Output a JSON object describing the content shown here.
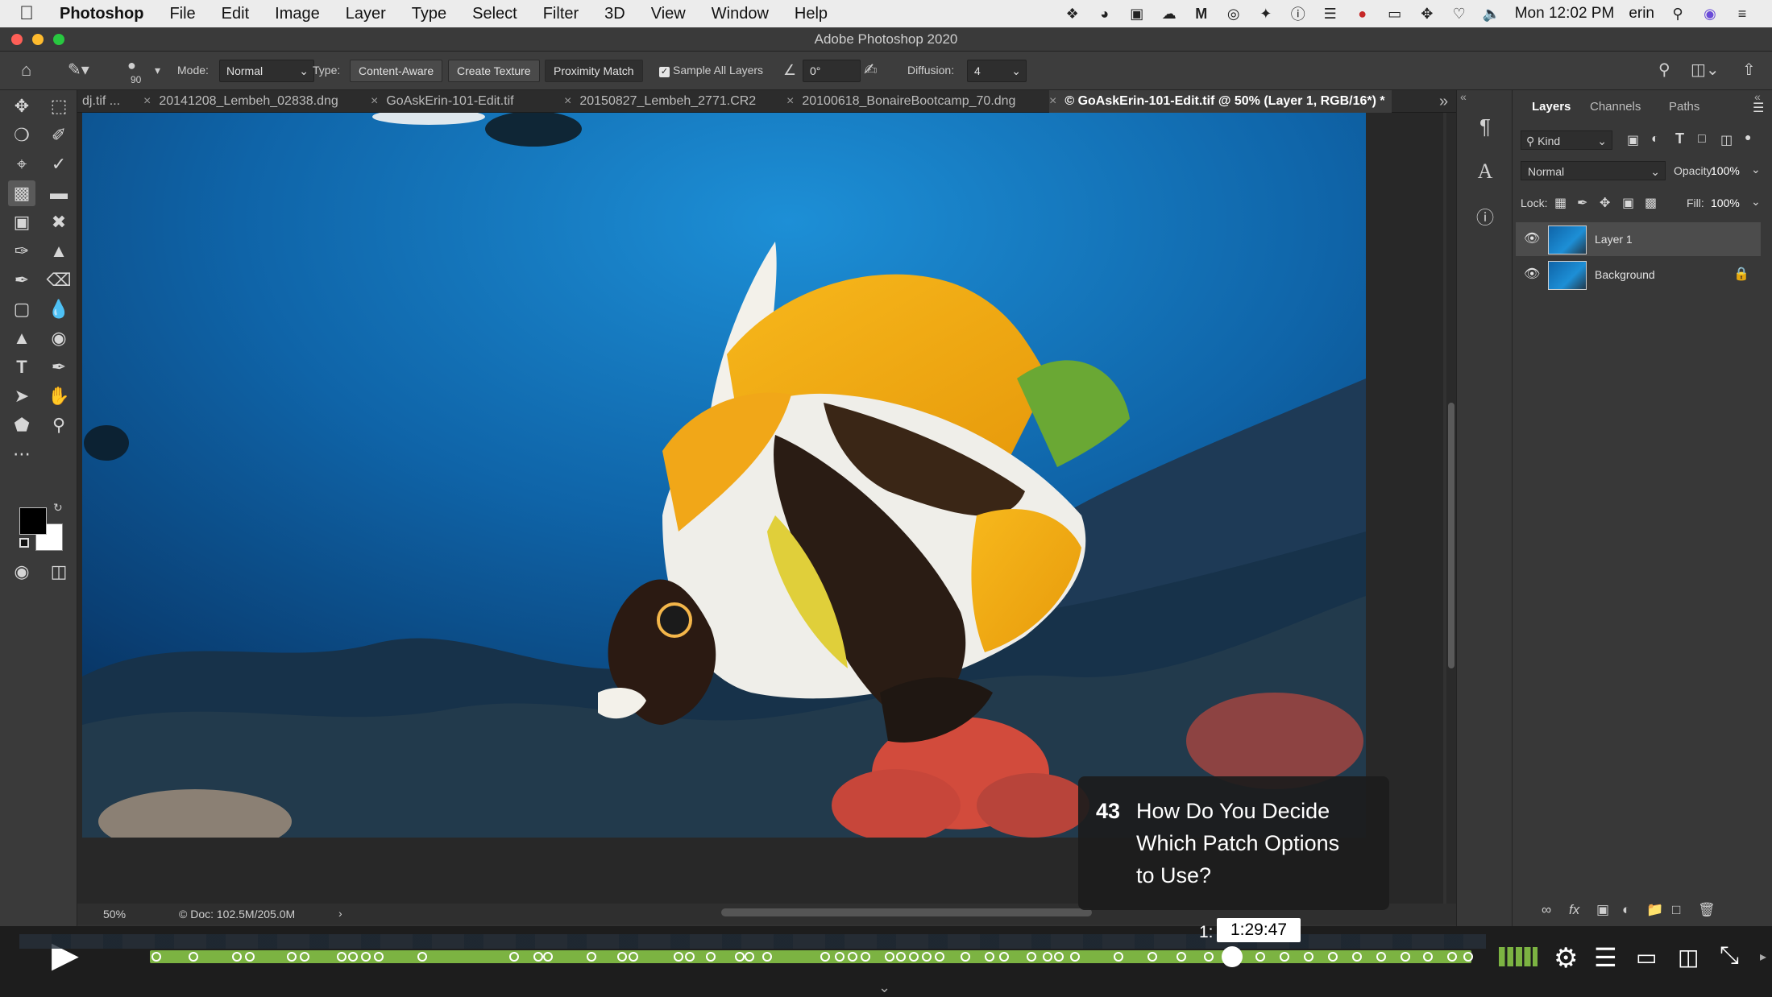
{
  "menubar": {
    "app": "Photoshop",
    "items": [
      "File",
      "Edit",
      "Image",
      "Layer",
      "Type",
      "Select",
      "Filter",
      "3D",
      "View",
      "Window",
      "Help"
    ],
    "clock": "Mon 12:02 PM",
    "user": "erin"
  },
  "window": {
    "title": "Adobe Photoshop 2020"
  },
  "options": {
    "brush_size": "90",
    "mode_label": "Mode:",
    "mode_value": "Normal",
    "type_label": "Type:",
    "type_options": [
      "Content-Aware",
      "Create Texture",
      "Proximity Match"
    ],
    "sample_all_layers": "Sample All Layers",
    "angle": "0°",
    "diffusion_label": "Diffusion:",
    "diffusion_value": "4"
  },
  "tabs": [
    "dj.tif ...",
    "20141208_Lembeh_02838.dng",
    "GoAskErin-101-Edit.tif",
    "20150827_Lembeh_2771.CR2",
    "20100618_BonaireBootcamp_70.dng",
    "© GoAskErin-101-Edit.tif @ 50% (Layer 1, RGB/16*) *"
  ],
  "status": {
    "zoom": "50%",
    "doc": "© Doc: 102.5M/205.0M"
  },
  "layers_panel": {
    "tabs": [
      "Layers",
      "Channels",
      "Paths"
    ],
    "kind": "Kind",
    "blend_mode": "Normal",
    "opacity_label": "Opacity:",
    "opacity": "100%",
    "lock_label": "Lock:",
    "fill_label": "Fill:",
    "fill": "100%",
    "layers": [
      {
        "name": "Layer 1",
        "selected": true
      },
      {
        "name": "Background",
        "selected": false,
        "locked": true
      }
    ]
  },
  "chapter": {
    "number": "43",
    "title_line1": "How Do You Decide",
    "title_line2": "Which Patch Options",
    "title_line3": "to Use?"
  },
  "player": {
    "time": "1:29:47",
    "time_prefix": "1:",
    "progress": 0.812
  },
  "colors": {
    "progress_green": "#7cb342",
    "ps_panel": "#383838",
    "menubar": "#ececec"
  }
}
